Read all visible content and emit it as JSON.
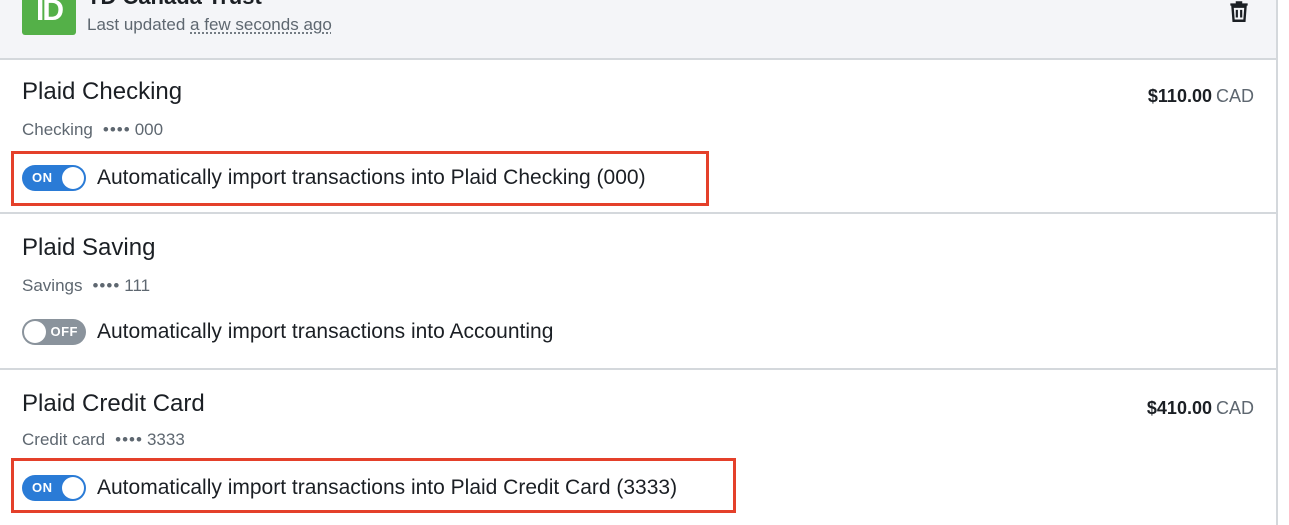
{
  "bank": {
    "logo_text": "ID",
    "name": "TD Canada Trust",
    "updated_prefix": "Last updated",
    "updated_ago": "a few seconds ago",
    "delete_icon": "trash-icon"
  },
  "accounts": [
    {
      "name": "Plaid Checking",
      "type": "Checking",
      "mask_dots": "••••",
      "mask": "000",
      "balance": "$110.00",
      "currency": "CAD",
      "toggle_state": "ON",
      "toggle_label": "Automatically import transactions into Plaid Checking (000)"
    },
    {
      "name": "Plaid Saving",
      "type": "Savings",
      "mask_dots": "••••",
      "mask": "111",
      "toggle_state": "OFF",
      "toggle_label": "Automatically import transactions into Accounting"
    },
    {
      "name": "Plaid Credit Card",
      "type": "Credit card",
      "mask_dots": "••••",
      "mask": "3333",
      "balance": "$410.00",
      "currency": "CAD",
      "toggle_state": "ON",
      "toggle_label": "Automatically import transactions into Plaid Credit Card (3333)"
    }
  ],
  "colors": {
    "toggle_on": "#2a7bd6",
    "toggle_off": "#8a939c",
    "highlight": "#e4402a",
    "bank_brand": "#54b048"
  }
}
